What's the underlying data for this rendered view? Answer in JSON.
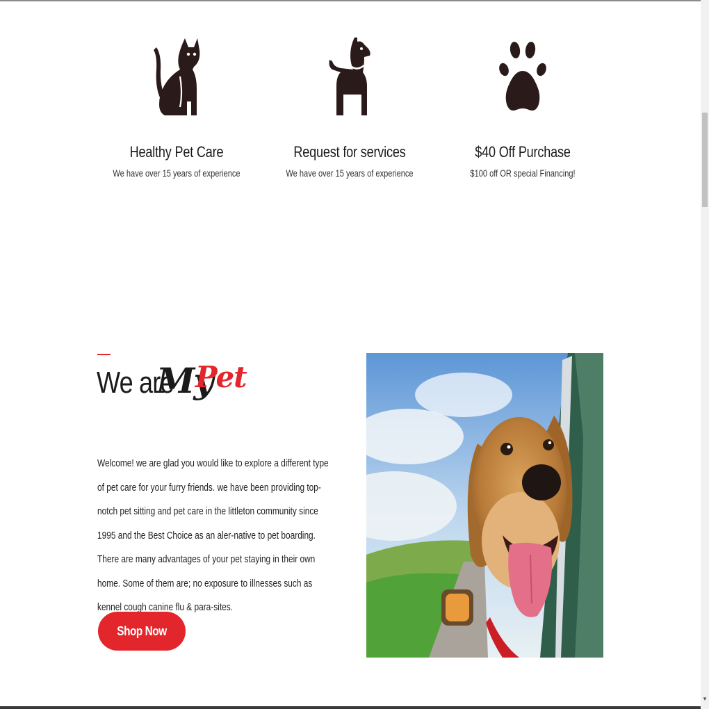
{
  "features": [
    {
      "icon": "cat-icon",
      "title": "Healthy Pet Care",
      "description": "We have over 15 years of experience"
    },
    {
      "icon": "dog-icon",
      "title": "Request for services",
      "description": "We have over 15 years of experience"
    },
    {
      "icon": "paw-icon",
      "title": "$40 Off Purchase",
      "description": "$100 off OR special Financing!"
    }
  ],
  "about": {
    "title_part1": "We are",
    "title_part2": "My",
    "title_part3": "Pet",
    "paragraph1": "Welcome! we are glad you would like to explore a different type of pet care for your furry friends. we have been providing top-notch pet sitting and pet care in the littleton community since 1995 and the Best Choice as an aler-native to pet boarding.",
    "paragraph2": "There are many advantages of your pet staying in their own home. Some of them are; no exposure to illnesses such as kennel cough canine flu & para-sites.",
    "button_label": "Shop Now",
    "image": "dog-in-car-window-photo"
  },
  "colors": {
    "accent": "#e2262c",
    "icon_dark": "#2b1a1a",
    "text": "#1a1a1a"
  },
  "scrollbar": {
    "down_arrow": "▾"
  }
}
